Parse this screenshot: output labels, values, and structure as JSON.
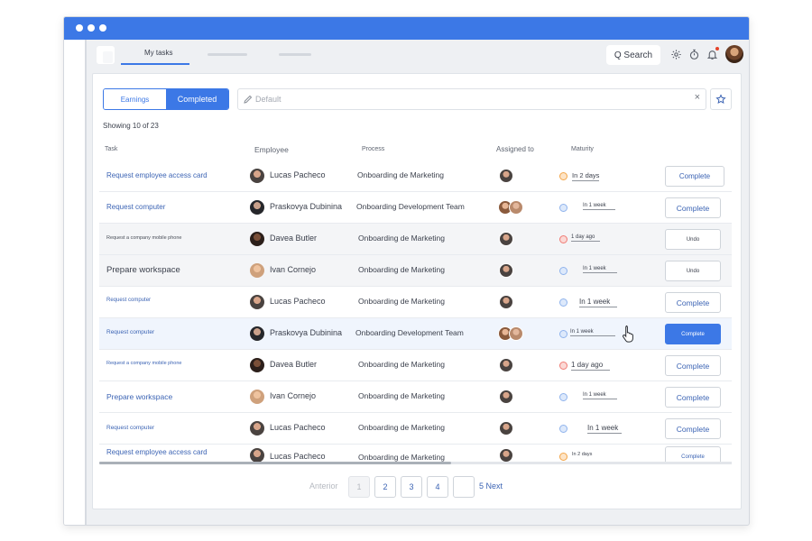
{
  "tabs": {
    "my_tasks": "My tasks"
  },
  "topbar": {
    "search_label": "Q Search"
  },
  "segmented": {
    "earnings": "Earnings",
    "completed": "Completed"
  },
  "filter": {
    "placeholder": "Default",
    "clear": "×"
  },
  "summary": {
    "showing": "Showing 10 of 23"
  },
  "columns": {
    "task": "Task",
    "employee": "Employee",
    "process": "Process",
    "assigned_to": "Assigned to",
    "maturity": "Maturity"
  },
  "rows": [
    {
      "task": "Request employee access card",
      "employee": "Lucas Pacheco",
      "process": "Onboarding de Marketing",
      "maturity": "In 2 days",
      "maturity_status": "orange",
      "action": "Complete"
    },
    {
      "task": "Request computer",
      "employee": "Praskovya Dubinina",
      "process": "Onboarding Development Team",
      "maturity": "In 1 week",
      "maturity_status": "blue",
      "action": "Complete"
    },
    {
      "task": "Request a company mobile phone",
      "employee": "Davea Butler",
      "process": "Onboarding de Marketing",
      "maturity": "1 day ago",
      "maturity_status": "red",
      "action": "Undo"
    },
    {
      "task": "Prepare workspace",
      "employee": "Ivan Cornejo",
      "process": "Onboarding de Marketing",
      "maturity": "In 1 week",
      "maturity_status": "blue",
      "action": "Undo"
    },
    {
      "task": "Request computer",
      "employee": "Lucas Pacheco",
      "process": "Onboarding de Marketing",
      "maturity": "In 1 week",
      "maturity_status": "blue",
      "action": "Complete"
    },
    {
      "task": "Request computer",
      "employee": "Praskovya Dubinina",
      "process": "Onboarding Development Team",
      "maturity": "In 1 week",
      "maturity_status": "blue",
      "action": "Complete"
    },
    {
      "task": "Request a company mobile phone",
      "employee": "Davea Butler",
      "process": "Onboarding de Marketing",
      "maturity": "1 day ago",
      "maturity_status": "red",
      "action": "Complete"
    },
    {
      "task": "Prepare workspace",
      "employee": "Ivan Cornejo",
      "process": "Onboarding de Marketing",
      "maturity": "In 1 week",
      "maturity_status": "blue",
      "action": "Complete"
    },
    {
      "task": "Request computer",
      "employee": "Lucas Pacheco",
      "process": "Onboarding de Marketing",
      "maturity": "In 1 week",
      "maturity_status": "blue",
      "action": "Complete"
    },
    {
      "task": "Request employee access card",
      "employee": "Lucas Pacheco",
      "process": "Onboarding de Marketing",
      "maturity": "In 2 days",
      "maturity_status": "orange",
      "action": "Complete"
    }
  ],
  "pagination": {
    "previous": "Anterior",
    "pages": [
      "1",
      "2",
      "3",
      "4"
    ],
    "current": "1",
    "next": "5 Next"
  },
  "colors": {
    "accent": "#3c78e6",
    "titlebar": "#3c78e6",
    "status_orange": "#f3a64a",
    "status_blue": "#8fb3ec",
    "status_red": "#ef7b74"
  },
  "icons": {
    "topbar": [
      "gear-icon",
      "stopwatch-icon",
      "bell-icon"
    ],
    "filter": [
      "pencil-icon",
      "close-icon"
    ],
    "star": "star-icon",
    "cursor": "pointer-hand-icon"
  }
}
